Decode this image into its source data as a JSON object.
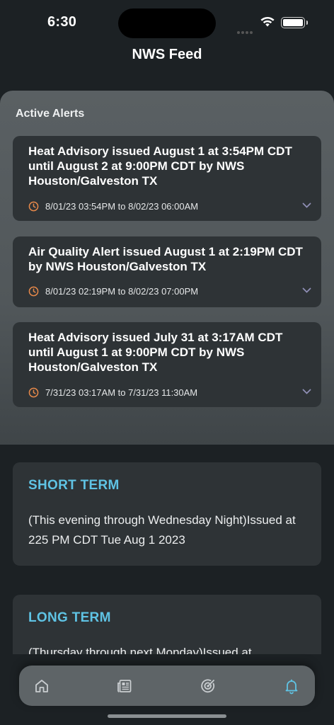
{
  "status_bar": {
    "time": "6:30"
  },
  "header": {
    "title": "NWS Feed"
  },
  "alerts": {
    "heading": "Active Alerts",
    "items": [
      {
        "title": "Heat Advisory issued August 1 at 3:54PM CDT until August 2 at 9:00PM CDT by NWS Houston/Galveston TX",
        "time_range": "8/01/23 03:54PM to 8/02/23 06:00AM"
      },
      {
        "title": "Air Quality Alert issued August 1 at 2:19PM CDT by NWS Houston/Galveston TX",
        "time_range": "8/01/23 02:19PM to 8/02/23 07:00PM"
      },
      {
        "title": "Heat Advisory issued July 31 at 3:17AM CDT until August 1 at 9:00PM CDT by NWS Houston/Galveston TX",
        "time_range": "7/31/23 03:17AM to 7/31/23 11:30AM"
      }
    ]
  },
  "forecast": {
    "short_term": {
      "title": "SHORT TERM",
      "body": "(This evening through Wednesday Night)Issued at 225 PM CDT Tue Aug 1 2023"
    },
    "long_term": {
      "title": "LONG TERM",
      "body": "(Thursday through next Monday)Issued at"
    }
  },
  "tab_bar": {
    "tabs": [
      {
        "icon": "home-icon",
        "active": false
      },
      {
        "icon": "newspaper-icon",
        "active": false
      },
      {
        "icon": "radar-icon",
        "active": false
      },
      {
        "icon": "bell-icon",
        "active": true
      }
    ]
  },
  "colors": {
    "background": "#1c2124",
    "card": "#2e3336",
    "accent": "#5fc3e4",
    "clock_icon": "#e8894a",
    "inactive_tab": "#c9cdd0",
    "active_tab": "#5fc3e4"
  }
}
